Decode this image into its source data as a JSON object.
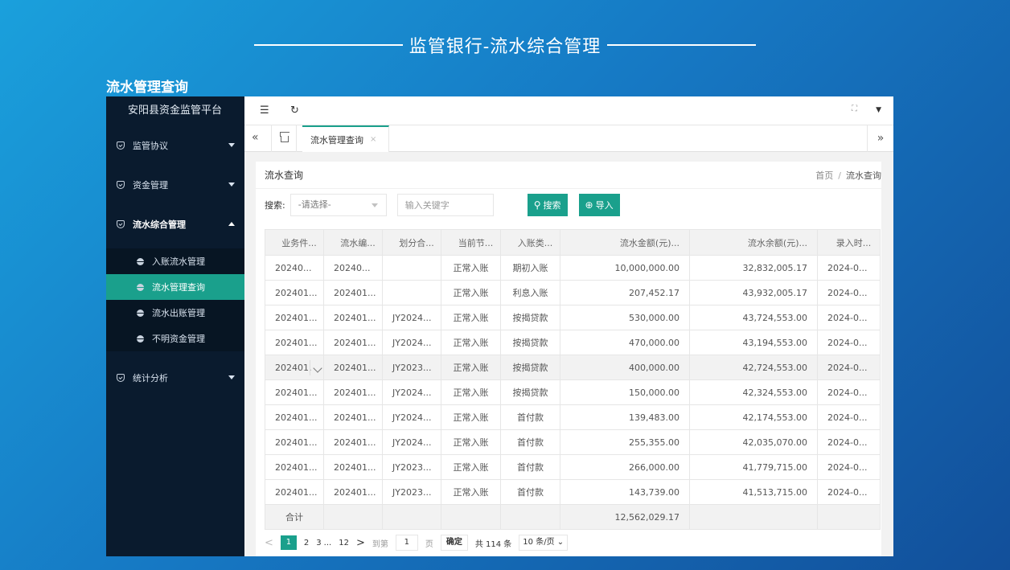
{
  "slide": {
    "title": "监管银行-流水综合管理",
    "section": "流水管理查询"
  },
  "sidebar": {
    "brand": "安阳县资金监管平台",
    "groups": [
      {
        "label": "监管协议"
      },
      {
        "label": "资金管理"
      },
      {
        "label": "流水综合管理"
      },
      {
        "label": "统计分析"
      }
    ],
    "subitems": [
      {
        "label": "入账流水管理"
      },
      {
        "label": "流水管理查询"
      },
      {
        "label": "流水出账管理"
      },
      {
        "label": "不明资金管理"
      }
    ]
  },
  "tabs": {
    "active": "流水管理查询",
    "close": "×"
  },
  "card": {
    "title": "流水查询",
    "breadcrumb": {
      "home": "首页",
      "sep": "/",
      "current": "流水查询"
    }
  },
  "search": {
    "label": "搜索:",
    "select_value": "-请选择-",
    "keyword_placeholder": "输入关键字",
    "search_button": "搜索",
    "import_button": "导入"
  },
  "table": {
    "headers": [
      "业务件...",
      "流水编...",
      "划分合...",
      "当前节...",
      "入账类...",
      "流水金额(元)...",
      "流水余额(元)...",
      "录入时..."
    ],
    "rows": [
      [
        "20240...",
        "20240...",
        "",
        "正常入账",
        "期初入账",
        "10,000,000.00",
        "32,832,005.17",
        "2024-0..."
      ],
      [
        "202401...",
        "202401...",
        "",
        "正常入账",
        "利息入账",
        "207,452.17",
        "43,932,005.17",
        "2024-0..."
      ],
      [
        "202401...",
        "202401...",
        "JY2024...",
        "正常入账",
        "按揭贷款",
        "530,000.00",
        "43,724,553.00",
        "2024-0..."
      ],
      [
        "202401...",
        "202401...",
        "JY2024...",
        "正常入账",
        "按揭贷款",
        "470,000.00",
        "43,194,553.00",
        "2024-0..."
      ],
      [
        "202401.",
        "202401...",
        "JY2023...",
        "正常入账",
        "按揭贷款",
        "400,000.00",
        "42,724,553.00",
        "2024-0..."
      ],
      [
        "202401...",
        "202401...",
        "JY2024...",
        "正常入账",
        "按揭贷款",
        "150,000.00",
        "42,324,553.00",
        "2024-0..."
      ],
      [
        "202401...",
        "202401...",
        "JY2024...",
        "正常入账",
        "首付款",
        "139,483.00",
        "42,174,553.00",
        "2024-0..."
      ],
      [
        "202401...",
        "202401...",
        "JY2024...",
        "正常入账",
        "首付款",
        "255,355.00",
        "42,035,070.00",
        "2024-0..."
      ],
      [
        "202401...",
        "202401...",
        "JY2023...",
        "正常入账",
        "首付款",
        "266,000.00",
        "41,779,715.00",
        "2024-0..."
      ],
      [
        "202401...",
        "202401...",
        "JY2023...",
        "正常入账",
        "首付款",
        "143,739.00",
        "41,513,715.00",
        "2024-0..."
      ]
    ],
    "total_label": "合计",
    "total_amount": "12,562,029.17"
  },
  "pager": {
    "prev": "<",
    "pages": [
      "1",
      "2",
      "3",
      "...",
      "12"
    ],
    "next": ">",
    "goto_label": "到第",
    "goto_value": "1",
    "page_unit": "页",
    "confirm": "确定",
    "total": "共 114 条",
    "page_size": "10 条/页"
  },
  "colors": {
    "accent": "#1aa08c",
    "sidebar": "#0a1b2e"
  }
}
